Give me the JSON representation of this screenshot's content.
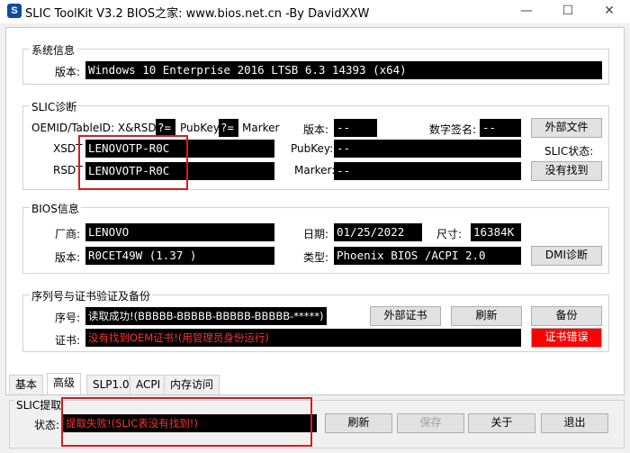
{
  "titlebar": {
    "title": "SLIC ToolKit V3.2    BIOS之家: www.bios.net.cn  -By DavidXXW",
    "minimize": "—",
    "maximize": "☐",
    "close": "✕"
  },
  "system": {
    "legend": "系统信息",
    "version_label": "版本:",
    "version_value": "Windows 10 Enterprise 2016 LTSB 6.3 14393    (x64)"
  },
  "slic": {
    "legend": "SLIC诊断",
    "oemid_label": "OEMID/TableID: X&RSDT",
    "q1": "?=",
    "pubkey_label": "PubKey",
    "q2": "?=",
    "marker_label": "Marker",
    "xsdt_label": "XSDT",
    "xsdt_value": "LENOVOTP-R0C",
    "rsdt_label": "RSDT",
    "rsdt_value": "LENOVOTP-R0C",
    "ver_label": "版本:",
    "ver_value": "--",
    "pubkey2_label": "PubKey:",
    "pubkey2_value": "--",
    "marker2_label": "Marker:",
    "marker2_value": "--",
    "sig_label": "数字签名:",
    "sig_value": "--",
    "ext_file_button": "外部文件",
    "status_label": "SLIC状态:",
    "status_button": "没有找到"
  },
  "bios": {
    "legend": "BIOS信息",
    "vendor_label": "厂商:",
    "vendor_value": "LENOVO",
    "version_label": "版本:",
    "version_value": "R0CET49W (1.37 )",
    "date_label": "日期:",
    "date_value": "01/25/2022",
    "size_label": "尺寸:",
    "size_value": "16384K",
    "type_label": "类型:",
    "type_value": "Phoenix BIOS /ACPI 2.0",
    "dmi_button": "DMI诊断"
  },
  "serial": {
    "legend": "序列号与证书验证及备份",
    "serial_label": "序号:",
    "serial_value": "读取成功!(BBBBB-BBBBB-BBBBB-BBBBB-*****)",
    "cert_label": "证书:",
    "cert_value": "没有找到OEM证书!(用管理员身份运行)",
    "ext_cert_button": "外部证书",
    "refresh_button": "刷新",
    "backup_button": "备份",
    "cert_error_button": "证书错误"
  },
  "tabs": [
    "基本",
    "高级",
    "SLP1.0",
    "ACPI",
    "内存访问"
  ],
  "extract": {
    "legend": "SLIC提取",
    "status_label": "状态:",
    "status_value": "提取失败!(SLIC表没有找到!)",
    "refresh_button": "刷新",
    "save_button": "保存",
    "about_button": "关于",
    "exit_button": "退出"
  }
}
